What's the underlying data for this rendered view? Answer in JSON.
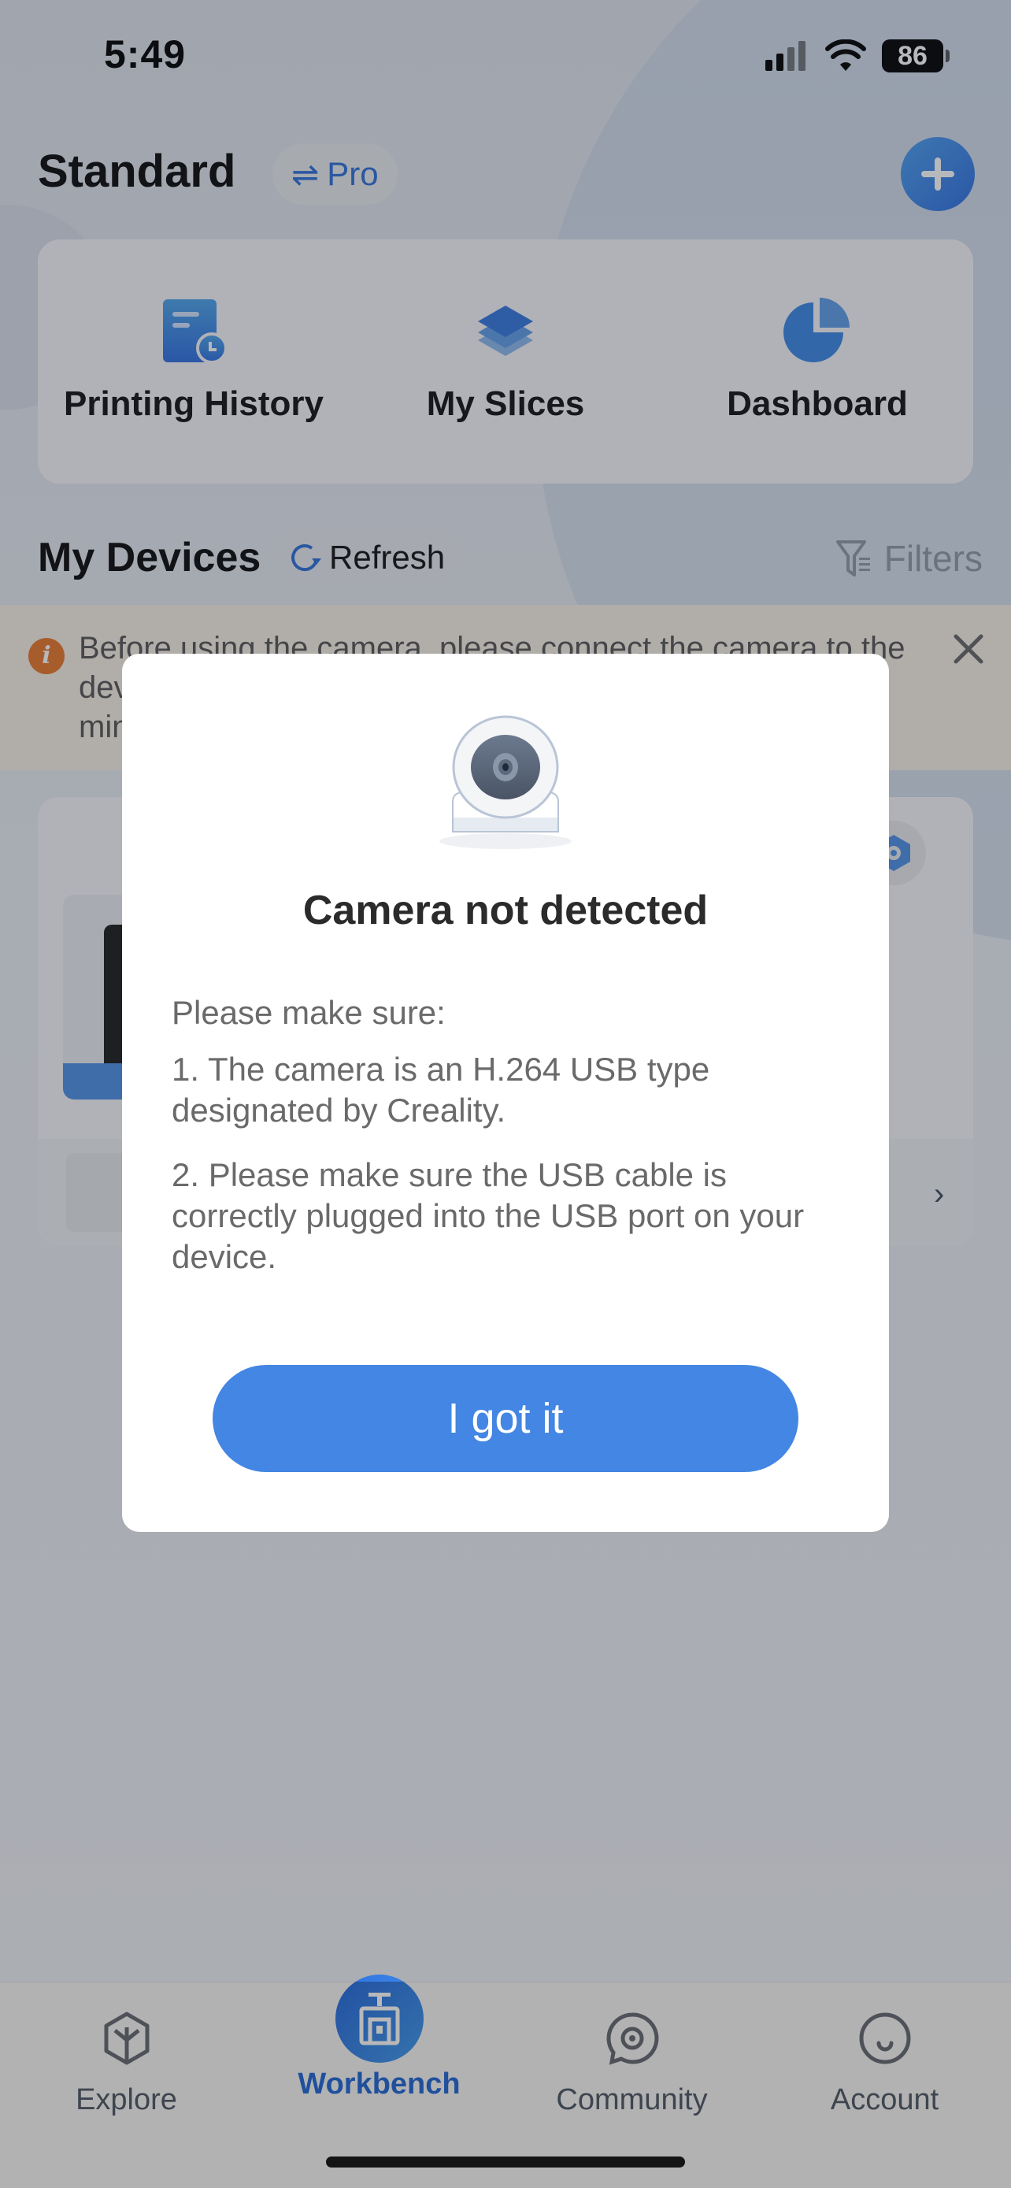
{
  "status_bar": {
    "time": "5:49",
    "battery": "86",
    "signal_bars_active": 2,
    "signal_bars_total": 4
  },
  "header": {
    "title": "Standard",
    "mode_switch_label": "Pro",
    "add_icon": "plus-icon"
  },
  "quick_actions": [
    {
      "label": "Printing History",
      "icon": "printing-history-icon"
    },
    {
      "label": "My Slices",
      "icon": "layers-icon"
    },
    {
      "label": "Dashboard",
      "icon": "pie-chart-icon"
    }
  ],
  "devices": {
    "title": "My Devices",
    "refresh_label": "Refresh",
    "filters_label": "Filters"
  },
  "banner": {
    "text": "Before using the camera, please connect the camera to the device and wait for it to initialize, then try again a few minutes after",
    "icon": "info-icon"
  },
  "device_card": {
    "settings_icon": "hex-nut-icon",
    "chevron_icon": "chevron-right-icon"
  },
  "modal": {
    "title": "Camera not detected",
    "intro": "Please make sure:",
    "items": [
      "1. The camera is an H.264 USB type designated by Creality.",
      "2. Please make sure the USB cable is correctly plugged into the USB port on your device."
    ],
    "confirm_label": "I got it"
  },
  "tabbar": {
    "active": "Workbench",
    "tabs": [
      {
        "label": "Explore",
        "icon": "explore-cube-icon"
      },
      {
        "label": "Workbench",
        "icon": "printer-icon"
      },
      {
        "label": "Community",
        "icon": "chat-bubble-icon"
      },
      {
        "label": "Account",
        "icon": "smile-face-icon"
      }
    ]
  },
  "colors": {
    "accent": "#4386e3",
    "tab_active": "#2d6fd8",
    "banner_bg": "#f7efe4",
    "banner_icon": "#e8772a",
    "modal_title": "#2b2b2b",
    "modal_body": "#6a6a6a"
  }
}
